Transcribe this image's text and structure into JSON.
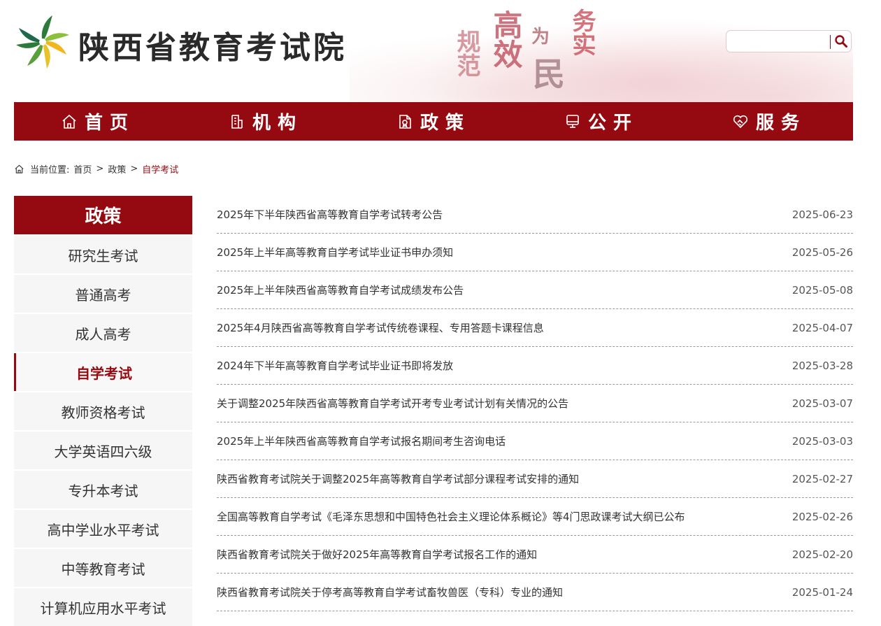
{
  "header": {
    "site_title": "陕西省教育考试院",
    "slogan": [
      "规范",
      "高效",
      "为",
      "民",
      "务实"
    ],
    "search_placeholder": ""
  },
  "nav": [
    {
      "label": "首页",
      "icon": "home-icon"
    },
    {
      "label": "机构",
      "icon": "building-icon"
    },
    {
      "label": "政策",
      "icon": "document-icon"
    },
    {
      "label": "公开",
      "icon": "monitor-icon"
    },
    {
      "label": "服务",
      "icon": "handshake-heart-icon"
    }
  ],
  "breadcrumb": {
    "prefix": "当前位置:",
    "items": [
      "首页",
      "政策"
    ],
    "current": "自学考试",
    "separator": ">"
  },
  "sidebar": {
    "title": "政策",
    "items": [
      "研究生考试",
      "普通高考",
      "成人高考",
      "自学考试",
      "教师资格考试",
      "大学英语四六级",
      "专升本考试",
      "高中学业水平考试",
      "中等教育考试",
      "计算机应用水平考试"
    ],
    "active_index": 3
  },
  "articles": [
    {
      "title": "2025年下半年陕西省高等教育自学考试转考公告",
      "date": "2025-06-23"
    },
    {
      "title": "2025年上半年高等教育自学考试毕业证书申办须知",
      "date": "2025-05-26"
    },
    {
      "title": "2025年上半年陕西省高等教育自学考试成绩发布公告",
      "date": "2025-05-08"
    },
    {
      "title": "2025年4月陕西省高等教育自学考试传统卷课程、专用答题卡课程信息",
      "date": "2025-04-07"
    },
    {
      "title": "2024年下半年高等教育自学考试毕业证书即将发放",
      "date": "2025-03-28"
    },
    {
      "title": "关于调整2025年陕西省高等教育自学考试开考专业考试计划有关情况的公告",
      "date": "2025-03-07"
    },
    {
      "title": "2025年上半年陕西省高等教育自学考试报名期间考生咨询电话",
      "date": "2025-03-03"
    },
    {
      "title": "陕西省教育考试院关于调整2025年高等教育自学考试部分课程考试安排的通知",
      "date": "2025-02-27"
    },
    {
      "title": "全国高等教育自学考试《毛泽东思想和中国特色社会主义理论体系概论》等4门思政课考试大纲已公布",
      "date": "2025-02-26"
    },
    {
      "title": "陕西省教育考试院关于做好2025年高等教育自学考试报名工作的通知",
      "date": "2025-02-20"
    },
    {
      "title": "陕西省教育考试院关于停考高等教育自学考试畜牧兽医（专科）专业的通知",
      "date": "2025-01-24"
    }
  ],
  "colors": {
    "brand": "#950a10",
    "sidebar_bg": "#f6f6f6"
  }
}
